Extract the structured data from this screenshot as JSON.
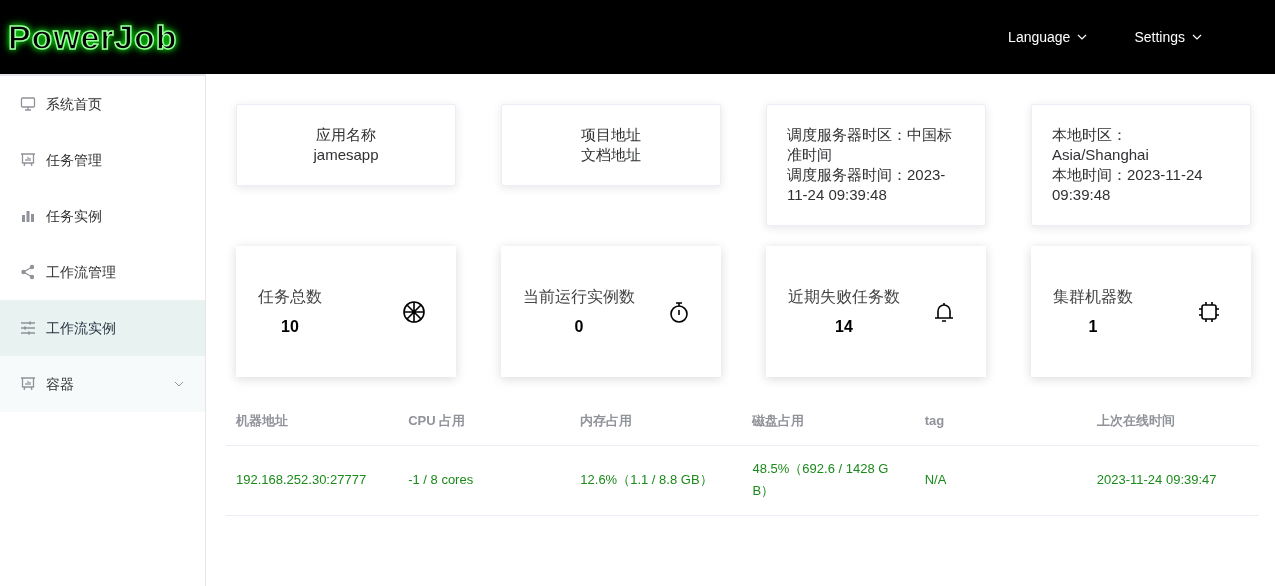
{
  "header": {
    "logo": "PowerJob",
    "menus": [
      {
        "label": "Language"
      },
      {
        "label": "Settings"
      }
    ]
  },
  "sidebar": {
    "items": [
      {
        "label": "系统首页",
        "selected": false
      },
      {
        "label": "任务管理",
        "selected": false
      },
      {
        "label": "任务实例",
        "selected": false
      },
      {
        "label": "工作流管理",
        "selected": false
      },
      {
        "label": "工作流实例",
        "selected": true
      },
      {
        "label": "容器",
        "selected": false,
        "expanded": false
      }
    ]
  },
  "info_cards": [
    {
      "lines": [
        "应用名称",
        "jamesapp"
      ]
    },
    {
      "lines": [
        "项目地址",
        "文档地址"
      ]
    },
    {
      "lines": [
        "调度服务器时区：中国标准时间",
        "调度服务器时间：2023-11-24 09:39:48"
      ]
    },
    {
      "lines": [
        "本地时区：Asia/Shanghai",
        "本地时间：2023-11-24 09:39:48"
      ]
    }
  ],
  "stat_cards": [
    {
      "label": "任务总数",
      "value": "10"
    },
    {
      "label": "当前运行实例数",
      "value": "0"
    },
    {
      "label": "近期失败任务数",
      "value": "14"
    },
    {
      "label": "集群机器数",
      "value": "1"
    }
  ],
  "table": {
    "columns": [
      "机器地址",
      "CPU 占用",
      "内存占用",
      "磁盘占用",
      "tag",
      "上次在线时间"
    ],
    "rows": [
      [
        "192.168.252.30:27777",
        "-1 / 8 cores",
        "12.6%（1.1 / 8.8 GB）",
        "48.5%（692.6 / 1428 GB）",
        "N/A",
        "2023-11-24 09:39:47"
      ]
    ]
  }
}
